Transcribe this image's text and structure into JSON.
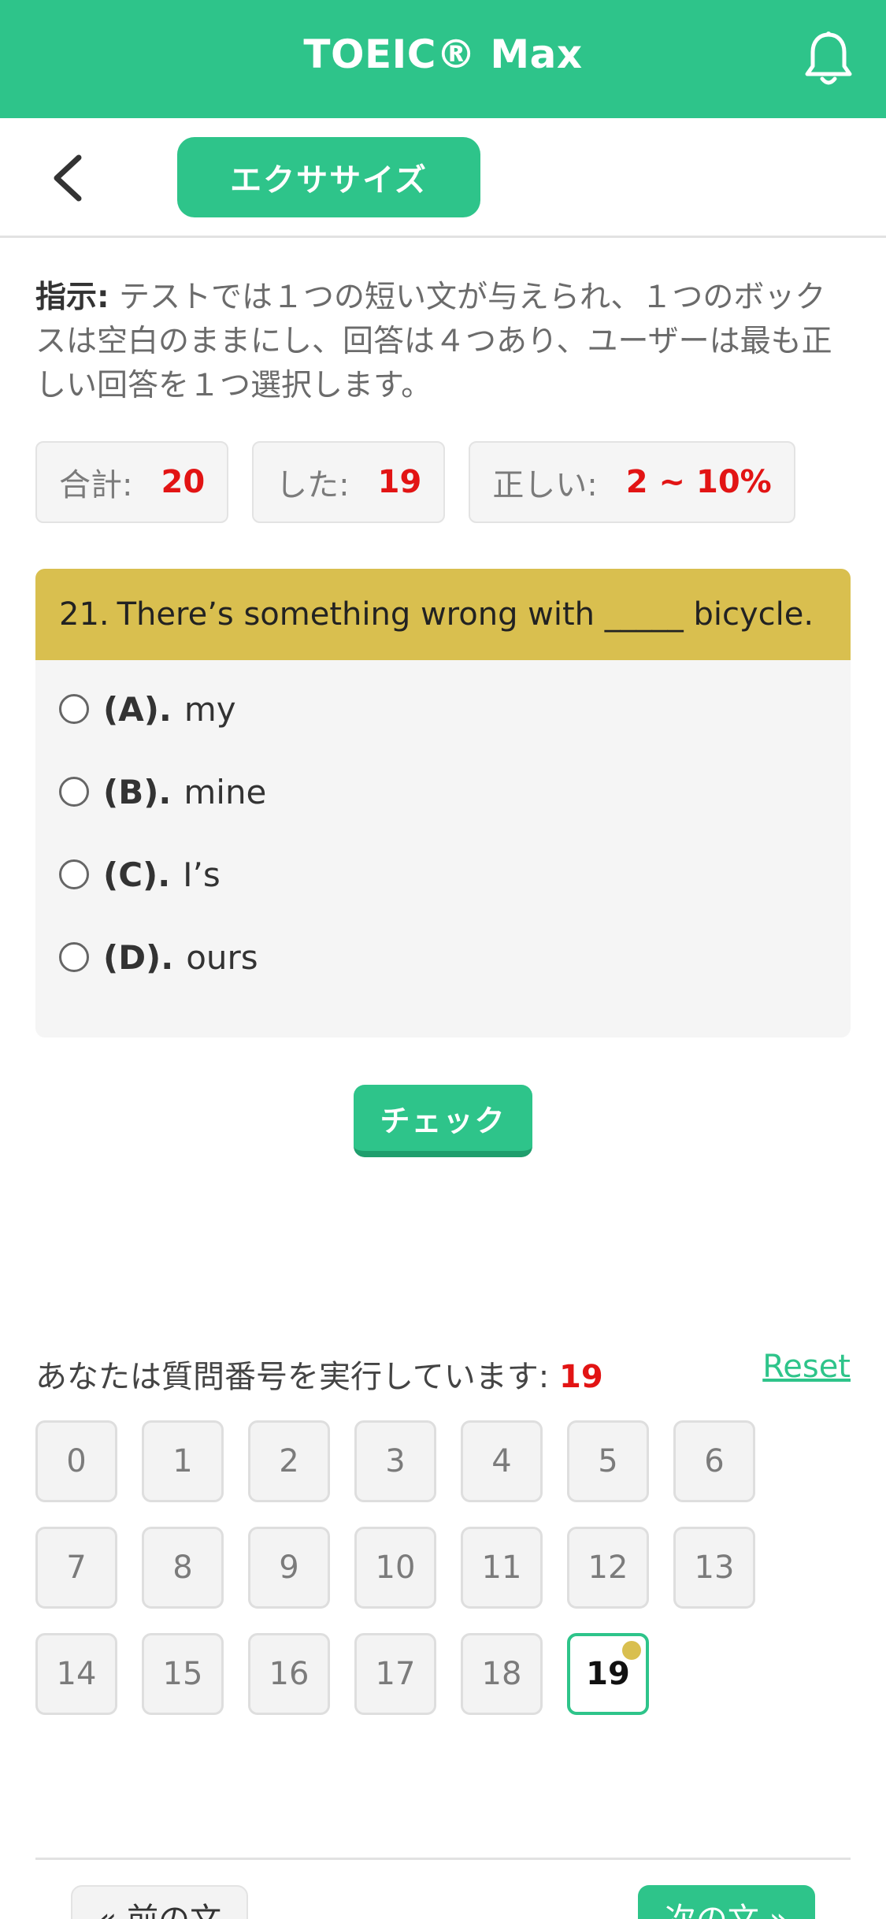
{
  "header": {
    "title": "TOEIC® Max",
    "notification_icon": "bell-icon"
  },
  "subheader": {
    "back_icon": "chevron-left-icon",
    "tab_label": "エクササイズ"
  },
  "instructions": {
    "label": "指示:",
    "text": " テストでは１つの短い文が与えられ、１つのボックスは空白のままにし、回答は４つあり、ユーザーは最も正しい回答を１つ選択します。"
  },
  "stats": [
    {
      "label": "合計:",
      "value": "20"
    },
    {
      "label": "した:",
      "value": "19"
    },
    {
      "label": "正しい:",
      "value": "2 ~ 10%"
    }
  ],
  "question": {
    "number": "21.",
    "text": "There’s something wrong with _____ bicycle.",
    "options": [
      {
        "letter": "(A).",
        "text": "my"
      },
      {
        "letter": "(B).",
        "text": "mine"
      },
      {
        "letter": "(C).",
        "text": "I’s"
      },
      {
        "letter": "(D).",
        "text": "ours"
      }
    ]
  },
  "check_button": "チェック",
  "progress": {
    "label": "あなたは質問番号を実行しています:",
    "current": "19",
    "reset": "Reset",
    "numbers": [
      "0",
      "1",
      "2",
      "3",
      "4",
      "5",
      "6",
      "7",
      "8",
      "9",
      "10",
      "11",
      "12",
      "13",
      "14",
      "15",
      "16",
      "17",
      "18",
      "19"
    ]
  },
  "nav": {
    "prev": "« 前の文",
    "next": "次の文 »"
  },
  "colors": {
    "primary": "#2ec48a",
    "accent": "#d9bf4f",
    "highlight": "#e21414"
  }
}
